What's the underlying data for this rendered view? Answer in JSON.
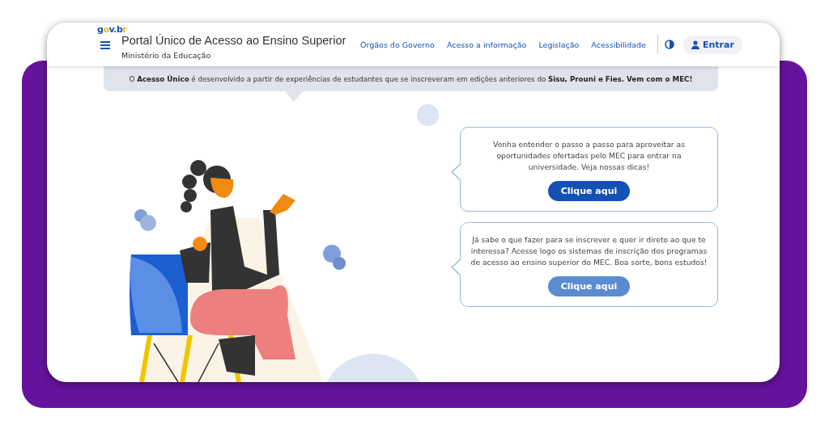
{
  "logo": "gov.br",
  "header": {
    "title": "Portal Único de Acesso ao Ensino Superior",
    "subtitle": "Ministério da Educação",
    "links": [
      "Órgãos do Governo",
      "Acesso a informação",
      "Legislação",
      "Acessibilidade"
    ],
    "login": "Entrar"
  },
  "banner": "O **Acesso Único** é desenvolvido a partir de experiências de estudantes que se inscreveram em edições anteriores do **Sisu, Prouni e Fies. Vem com o MEC!**",
  "cards": [
    {
      "text": "Venha entender o passo a passo para aproveitar as oportunidades ofertadas pelo MEC para entrar na universidade. Veja nossas dicas!",
      "button": "Clique aqui",
      "kind": "dark"
    },
    {
      "text": "Já sabe o que fazer para se inscrever e quer ir direto ao que te interessa? Acesse logo os sistemas de inscrição dos programas de acesso ao ensino superior do MEC. Boa sorte, bons estudos!",
      "button": "Clique aqui",
      "kind": "light"
    }
  ]
}
